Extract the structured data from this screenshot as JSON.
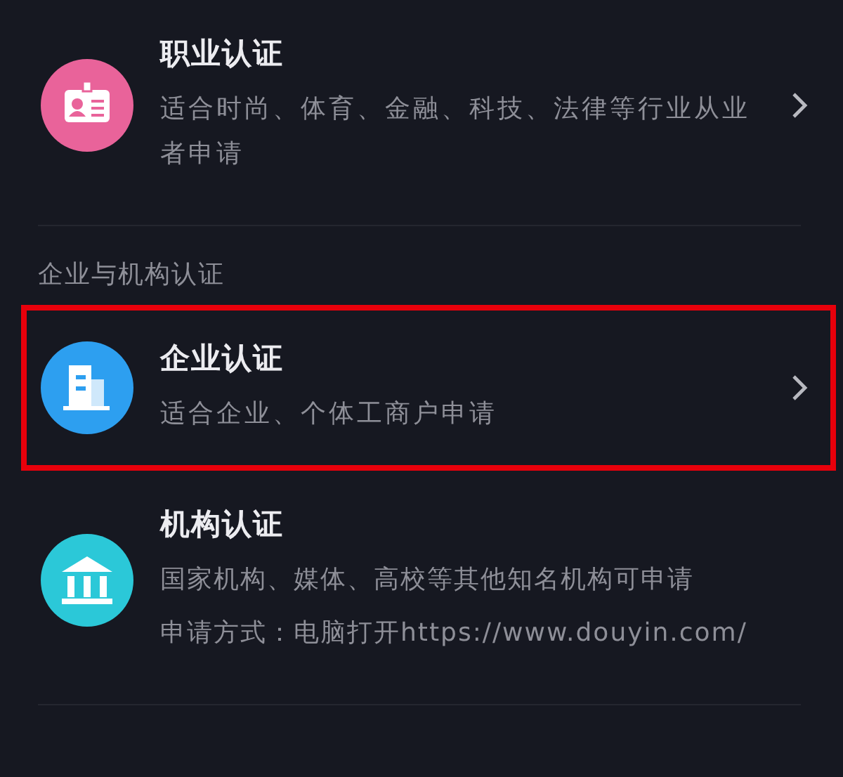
{
  "groups": [
    {
      "items": [
        {
          "kind": "id-card",
          "color": "#e9639a",
          "title": "职业认证",
          "description": [
            "适合时尚、体育、金融、科技、法律等行业从业者申请"
          ],
          "highlighted": false,
          "chevron": true
        }
      ]
    },
    {
      "header": "企业与机构认证",
      "items": [
        {
          "kind": "building",
          "color": "#2d9ff0",
          "title": "企业认证",
          "description": [
            "适合企业、个体工商户申请"
          ],
          "highlighted": true,
          "chevron": true
        },
        {
          "kind": "bank",
          "color": "#2bc8d8",
          "title": "机构认证",
          "description": [
            "国家机构、媒体、高校等其他知名机构可申请",
            "申请方式：电脑打开https://www.douyin.com/"
          ],
          "highlighted": false,
          "chevron": false
        }
      ]
    }
  ]
}
